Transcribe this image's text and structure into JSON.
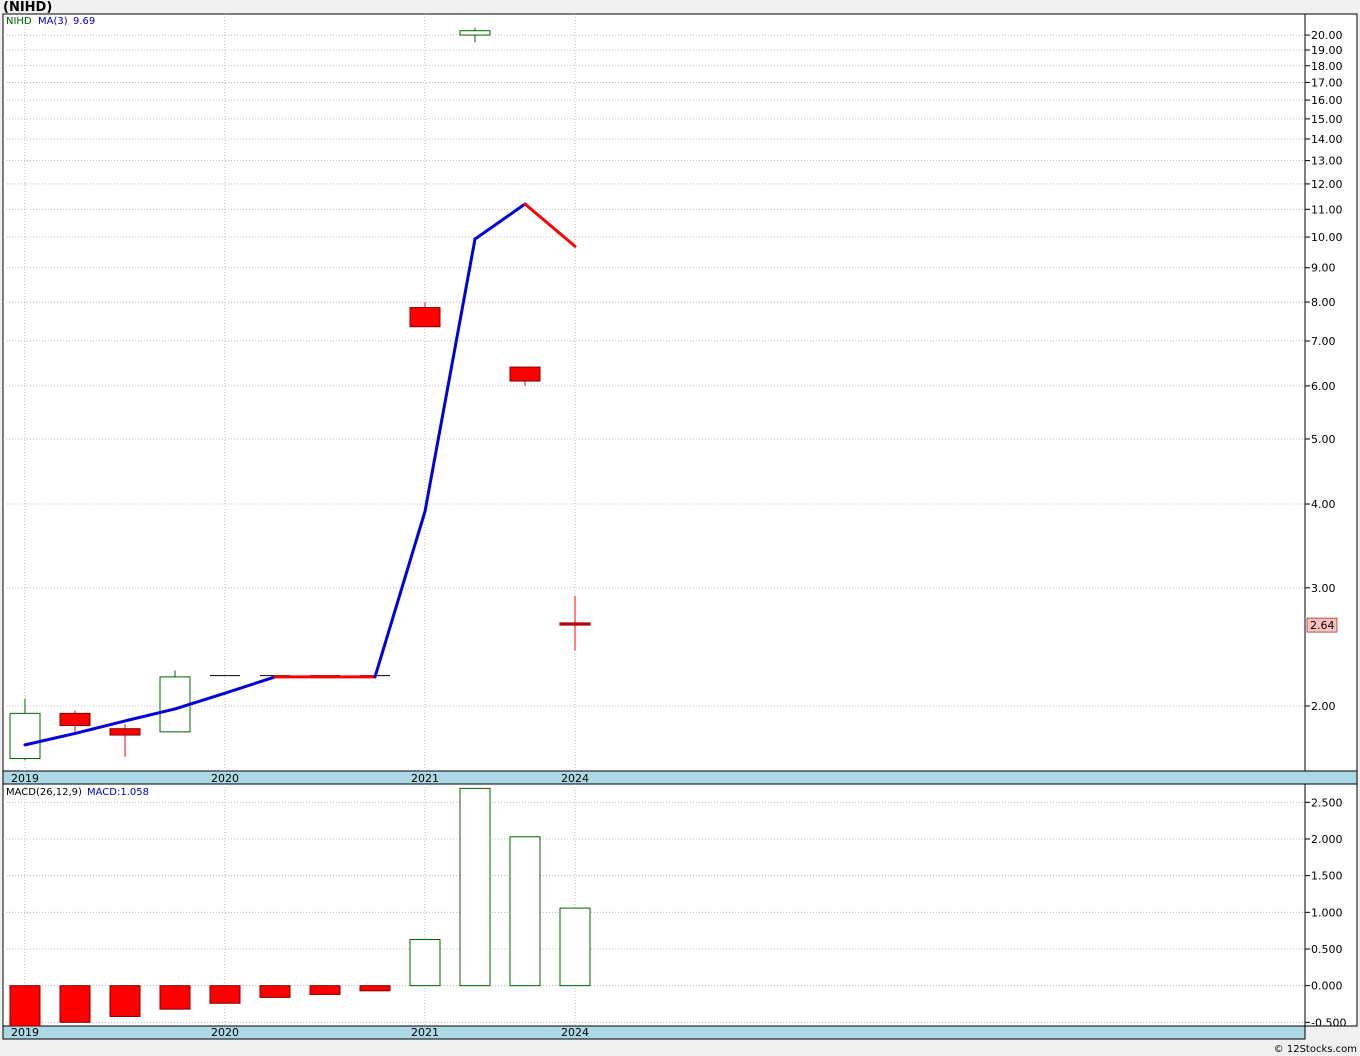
{
  "title": "(NIHD)",
  "watermark": "© 12Stocks.com",
  "colors": {
    "up": "#006400",
    "down": "#ff0000",
    "ma_up": "#0000dd",
    "ma_down": "#ff0000",
    "axis_band": "#add8e6",
    "last_price_bg": "#ffc0c0"
  },
  "price_panel": {
    "legend": {
      "symbol": "NIHD",
      "ma_label": "MA(3)",
      "ma_value": "9.69"
    },
    "scale": "log",
    "y_ticks": [
      "2.00",
      "3.00",
      "4.00",
      "5.00",
      "6.00",
      "7.00",
      "8.00",
      "9.00",
      "10.00",
      "11.00",
      "12.00",
      "13.00",
      "14.00",
      "15.00",
      "16.00",
      "17.00",
      "18.00",
      "19.00",
      "20.00"
    ],
    "last_price": "2.64",
    "x_labels": [
      {
        "label": "2019",
        "index": 0
      },
      {
        "label": "2020",
        "index": 4
      },
      {
        "label": "2021",
        "index": 8
      },
      {
        "label": "2024",
        "index": 11
      }
    ]
  },
  "macd_panel": {
    "legend": {
      "label": "MACD(26,12,9)",
      "value_label": "MACD:1.058"
    },
    "y_ticks": [
      "2.500",
      "2.000",
      "1.500",
      "1.000",
      "0.500",
      "0.000",
      "-0.500"
    ],
    "x_labels": [
      {
        "label": "2019",
        "index": 0
      },
      {
        "label": "2020",
        "index": 4
      },
      {
        "label": "2021",
        "index": 8
      },
      {
        "label": "2024",
        "index": 11
      }
    ]
  },
  "chart_data": [
    {
      "type": "candlestick",
      "title": "(NIHD)",
      "scale": "log",
      "ylim": [
        1.6,
        21.5
      ],
      "candles": [
        {
          "open": 1.67,
          "high": 2.05,
          "low": 1.66,
          "close": 1.95
        },
        {
          "open": 1.95,
          "high": 1.97,
          "low": 1.83,
          "close": 1.87
        },
        {
          "open": 1.85,
          "high": 1.88,
          "low": 1.68,
          "close": 1.81
        },
        {
          "open": 1.83,
          "high": 2.26,
          "low": 1.83,
          "close": 2.21
        },
        {
          "open": 2.22,
          "high": 2.22,
          "low": 2.22,
          "close": 2.22
        },
        {
          "open": 2.22,
          "high": 2.22,
          "low": 2.22,
          "close": 2.22
        },
        {
          "open": 2.22,
          "high": 2.22,
          "low": 2.22,
          "close": 2.22
        },
        {
          "open": 2.22,
          "high": 2.22,
          "low": 2.22,
          "close": 2.22
        },
        {
          "open": 7.85,
          "high": 8.0,
          "low": 7.35,
          "close": 7.35
        },
        {
          "open": 20.0,
          "high": 20.5,
          "low": 19.5,
          "close": 20.3
        },
        {
          "open": 6.4,
          "high": 6.4,
          "low": 6.0,
          "close": 6.1
        },
        {
          "open": 2.66,
          "high": 2.92,
          "low": 2.42,
          "close": 2.64
        }
      ],
      "ma": {
        "name": "MA(3)",
        "values": [
          1.75,
          1.82,
          1.9,
          1.98,
          2.09,
          2.21,
          2.21,
          2.21,
          3.9,
          9.93,
          11.2,
          9.69
        ]
      }
    },
    {
      "type": "bar",
      "title": "MACD(26,12,9)",
      "ylim": [
        -0.55,
        2.75
      ],
      "values": [
        -0.55,
        -0.5,
        -0.42,
        -0.32,
        -0.24,
        -0.16,
        -0.12,
        -0.07,
        0.63,
        2.69,
        2.03,
        1.058
      ]
    }
  ]
}
